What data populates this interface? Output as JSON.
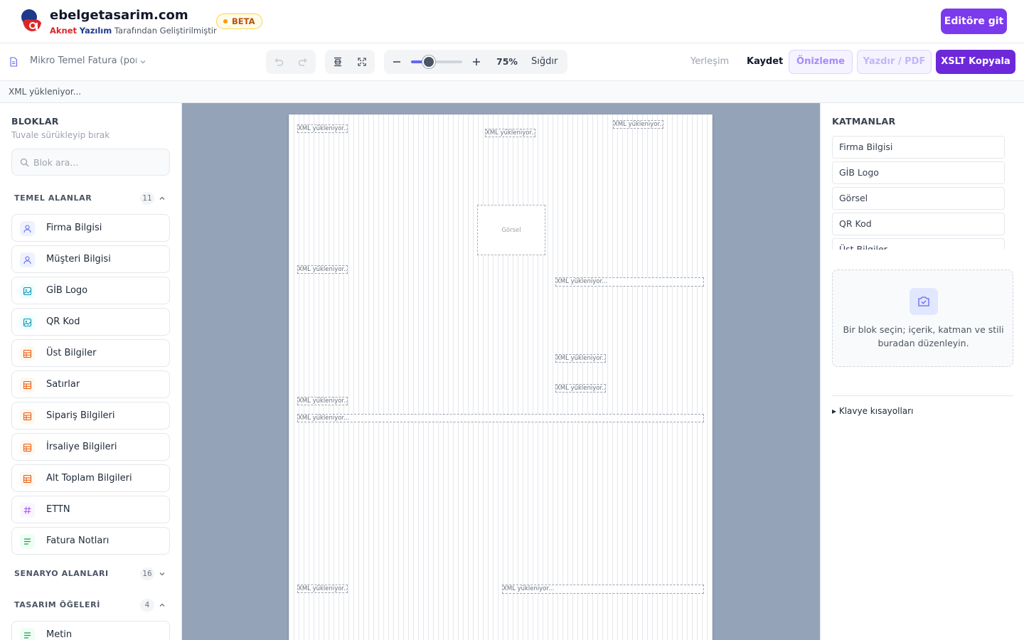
{
  "header": {
    "brand_title": "ebelgetasarim.com",
    "brand_sub_red": "Aknet",
    "brand_sub_blue": "Yazılım",
    "brand_sub_rest": "Tarafından Geliştirilmiştir",
    "beta_label": "BETA",
    "editor_button": "Editöre git"
  },
  "toolbar": {
    "template_name": "Mikro Temel Fatura (por",
    "zoom_value": "75%",
    "zoom_level": 0.3,
    "fit_label": "Sığdır",
    "layout_label": "Yerleşim",
    "save_label": "Kaydet",
    "preview_label": "Önizleme",
    "print_label": "Yazdır / PDF",
    "xslt_label": "XSLT Kopyala"
  },
  "status": {
    "text": "XML yükleniyor..."
  },
  "sidebar": {
    "title": "BLOKLAR",
    "subtitle": "Tuvale sürükleyip bırak",
    "search_placeholder": "Blok ara...",
    "categories": [
      {
        "label": "TEMEL ALANLAR",
        "count": "11",
        "items": [
          {
            "label": "Firma Bilgisi",
            "icon": "user-icon"
          },
          {
            "label": "Müşteri Bilgisi",
            "icon": "user-icon"
          },
          {
            "label": "GİB Logo",
            "icon": "image-icon"
          },
          {
            "label": "QR Kod",
            "icon": "image-icon"
          },
          {
            "label": "Üst Bilgiler",
            "icon": "table-icon"
          },
          {
            "label": "Satırlar",
            "icon": "table-icon"
          },
          {
            "label": "Sipariş Bilgileri",
            "icon": "table-icon"
          },
          {
            "label": "İrsaliye Bilgileri",
            "icon": "table-icon"
          },
          {
            "label": "Alt Toplam Bilgileri",
            "icon": "table-icon"
          },
          {
            "label": "ETTN",
            "icon": "hash-icon"
          },
          {
            "label": "Fatura Notları",
            "icon": "text-icon"
          }
        ]
      },
      {
        "label": "SENARYO ALANLARI",
        "count": "16"
      },
      {
        "label": "TASARIM ÖĞELERİ",
        "count": "4",
        "items": [
          {
            "label": "Metin",
            "icon": "text-icon"
          }
        ]
      }
    ]
  },
  "canvas": {
    "field_text": "XML yükleniyor...",
    "image_placeholder": "Görsel"
  },
  "right": {
    "title": "KATMANLAR",
    "layers": [
      "Firma Bilgisi",
      "GİB Logo",
      "Görsel",
      "QR Kod",
      "Üst Bilgiler"
    ],
    "empty_text": "Bir blok seçin; içerik, katman ve stili buradan düzenleyin.",
    "shortcuts_label": "▸ Klavye kısayolları"
  },
  "colors": {
    "accent": "#7c3aed",
    "indigo": "#6366f1",
    "canvas_bg": "#94a3b8"
  }
}
